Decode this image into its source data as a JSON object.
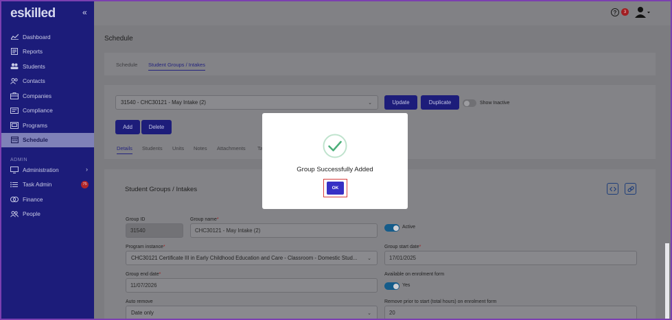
{
  "app": {
    "logo": "eskilled",
    "collapse_icon": "double-chevron-left-icon"
  },
  "sidebar": {
    "items": [
      {
        "label": "Dashboard",
        "icon": "chart-line-icon"
      },
      {
        "label": "Reports",
        "icon": "report-icon"
      },
      {
        "label": "Students",
        "icon": "users-icon"
      },
      {
        "label": "Contacts",
        "icon": "contacts-icon"
      },
      {
        "label": "Companies",
        "icon": "building-icon"
      },
      {
        "label": "Compliance",
        "icon": "id-card-icon"
      },
      {
        "label": "Programs",
        "icon": "folder-icon"
      },
      {
        "label": "Schedule",
        "icon": "calendar-icon",
        "active": true
      }
    ],
    "admin_section_label": "ADMIN",
    "admin_items": [
      {
        "label": "Administration",
        "icon": "monitor-icon"
      },
      {
        "label": "Task Admin",
        "icon": "list-icon",
        "badge": "75"
      },
      {
        "label": "Finance",
        "icon": "coins-icon"
      },
      {
        "label": "People",
        "icon": "people-icon"
      }
    ]
  },
  "topbar": {
    "help_badge": "3"
  },
  "page": {
    "title": "Schedule",
    "tabs": [
      {
        "label": "Schedule"
      },
      {
        "label": "Student Groups / Intakes",
        "active": true
      }
    ],
    "group_select": "31540 - CHC30121 - May Intake (2)",
    "update_label": "Update",
    "duplicate_label": "Duplicate",
    "show_inactive_label": "Show Inactive",
    "add_label": "Add",
    "delete_label": "Delete",
    "sub_tabs": [
      "Details",
      "Students",
      "Units",
      "Notes",
      "Attachments",
      "Ta"
    ]
  },
  "details": {
    "section_title": "Student Groups / Intakes",
    "group_id_label": "Group ID",
    "group_id_value": "31540",
    "group_name_label": "Group name",
    "group_name_value": "CHC30121 - May Intake (2)",
    "active_label": "Active",
    "program_instance_label": "Program instance",
    "program_instance_value": "CHC30121 Certificate III in Early Childhood Education and Care - Classroom - Domestic Stud...",
    "group_start_label": "Group start date",
    "group_start_value": "17/01/2025",
    "group_end_label": "Group end date",
    "group_end_value": "11/07/2026",
    "available_label": "Available on enrolment form",
    "yes_label": "Yes",
    "auto_remove_label": "Auto remove",
    "auto_remove_value": "Date only",
    "remove_prior_label": "Remove prior to start (total hours) on enrolment form",
    "remove_prior_value": "20",
    "required_mark": "*"
  },
  "modal": {
    "message": "Group Successfully Added",
    "ok_label": "OK"
  },
  "colors": {
    "sidebar": "#1c1c7a",
    "accent": "#3730c5",
    "success": "#4caf7a",
    "highlight": "#d63b3b"
  }
}
